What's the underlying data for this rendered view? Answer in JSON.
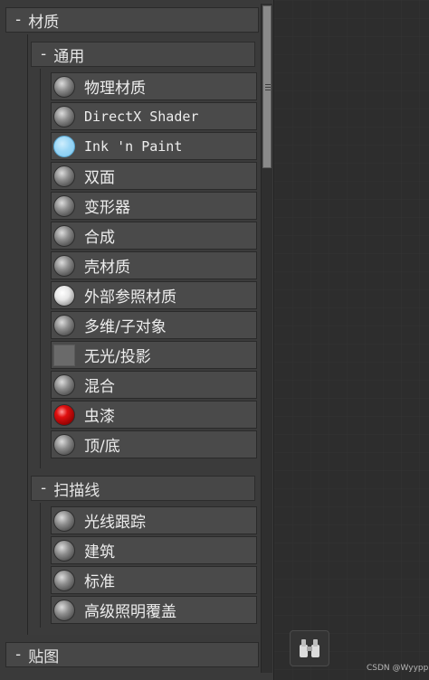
{
  "browser": {
    "categories": [
      {
        "title": "材质",
        "expand_glyph": "-",
        "groups": [
          {
            "title": "通用",
            "expand_glyph": "-",
            "items": [
              {
                "label": "物理材质",
                "swatch": "gray-sphere-icon"
              },
              {
                "label": "DirectX Shader",
                "swatch": "gray-sphere-icon"
              },
              {
                "label": "Ink 'n Paint",
                "swatch": "light-blue-sphere-icon"
              },
              {
                "label": "双面",
                "swatch": "gray-sphere-icon"
              },
              {
                "label": "变形器",
                "swatch": "gray-sphere-icon"
              },
              {
                "label": "合成",
                "swatch": "gray-sphere-icon"
              },
              {
                "label": "壳材质",
                "swatch": "gray-sphere-icon"
              },
              {
                "label": "外部参照材质",
                "swatch": "white-sphere-icon"
              },
              {
                "label": "多维/子对象",
                "swatch": "gray-sphere-icon"
              },
              {
                "label": "无光/投影",
                "swatch": "gray-square-icon"
              },
              {
                "label": "混合",
                "swatch": "gray-sphere-icon"
              },
              {
                "label": "虫漆",
                "swatch": "red-sphere-icon"
              },
              {
                "label": "顶/底",
                "swatch": "gray-sphere-icon"
              }
            ]
          },
          {
            "title": "扫描线",
            "expand_glyph": "-",
            "items": [
              {
                "label": "光线跟踪",
                "swatch": "gray-sphere-icon"
              },
              {
                "label": "建筑",
                "swatch": "gray-sphere-icon"
              },
              {
                "label": "标准",
                "swatch": "gray-sphere-icon"
              },
              {
                "label": "高级照明覆盖",
                "swatch": "gray-sphere-icon"
              }
            ]
          }
        ]
      },
      {
        "title": "贴图",
        "expand_glyph": "-"
      }
    ]
  },
  "right_panel": {
    "search_button_icon": "binoculars-icon"
  },
  "watermark": "CSDN @Wyypp",
  "colors": {
    "swatch_blue": "#8fd0f2",
    "swatch_red": "#d40000",
    "panel_bg": "#3a3a3a",
    "item_bg": "#4a4a4a"
  }
}
